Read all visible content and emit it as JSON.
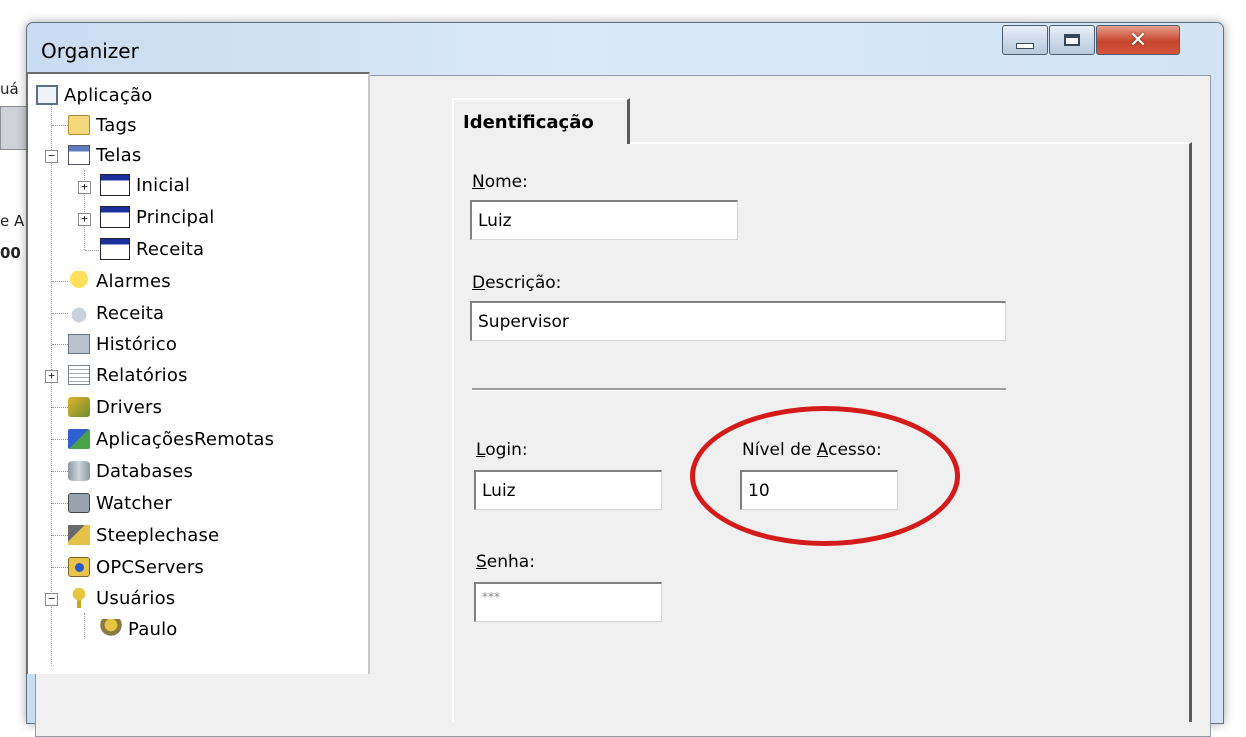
{
  "background_app": {
    "fragments": [
      "uá",
      "e A",
      "00"
    ]
  },
  "window": {
    "title": "Organizer",
    "minimize_glyph": "–",
    "maximize_glyph": "□",
    "close_glyph": "✕"
  },
  "tree": {
    "root": "Aplicação",
    "nodes": {
      "tags": "Tags",
      "telas": "Telas",
      "inicial": "Inicial",
      "principal": "Principal",
      "receita_tela": "Receita",
      "alarmes": "Alarmes",
      "receita": "Receita",
      "historico": "Histórico",
      "relatorios": "Relatórios",
      "drivers": "Drivers",
      "aplicacoes_remotas": "AplicaçõesRemotas",
      "databases": "Databases",
      "watcher": "Watcher",
      "steeplechase": "Steeplechase",
      "opcservers": "OPCServers",
      "usuarios": "Usuários",
      "paulo": "Paulo"
    },
    "expanders": {
      "telas": "−",
      "inicial": "+",
      "principal": "+",
      "relatorios": "+",
      "usuarios": "−"
    }
  },
  "tabs": [
    {
      "label": "Identificação",
      "active": true
    }
  ],
  "form": {
    "nome": {
      "label_mnemonic": "N",
      "label_rest": "ome:",
      "value": "Luiz"
    },
    "descricao": {
      "label_mnemonic": "D",
      "label_rest": "escrição:",
      "value": "Supervisor"
    },
    "login": {
      "label_mnemonic": "L",
      "label_rest": "ogin:",
      "value": "Luiz"
    },
    "nivel_acesso": {
      "label_before": "Nível de ",
      "label_mnemonic": "A",
      "label_rest": "cesso:",
      "value": "10"
    },
    "senha": {
      "label_mnemonic": "S",
      "label_rest": "enha:",
      "value": "***"
    }
  },
  "annotation": {
    "color": "#d41a1a"
  }
}
